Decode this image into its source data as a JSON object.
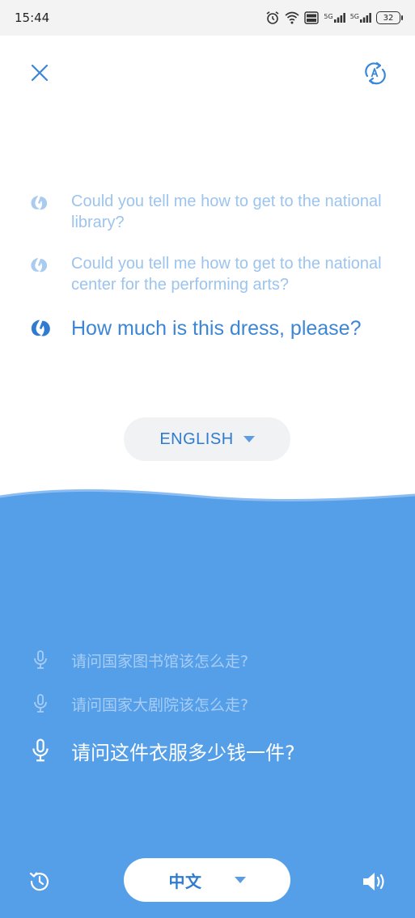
{
  "status": {
    "time": "15:44",
    "battery": "32",
    "network1": "5G",
    "network2": "5G"
  },
  "colors": {
    "accent": "#2f7bd0",
    "blue_panel": "#559fe9",
    "history_text_faded": "#9cc4ee",
    "pill_top_bg": "#f1f2f4"
  },
  "icons": {
    "close": "close-icon",
    "swap": "swap-language-icon",
    "speaker_source": "translate-logo-icon",
    "mic": "microphone-icon",
    "history": "history-icon",
    "speaker": "speaker-icon"
  },
  "english_history": [
    {
      "text": "Could you tell me how to get to the national library?"
    },
    {
      "text": "Could you tell me how to get to the national center for the performing arts?"
    }
  ],
  "english_current": "How much is this dress, please?",
  "top_language": "ENGLISH",
  "chinese_history": [
    {
      "text": "请问国家图书馆该怎么走?"
    },
    {
      "text": "请问国家大剧院该怎么走?"
    }
  ],
  "chinese_current": "请问这件衣服多少钱一件?",
  "bottom_language": "中文"
}
